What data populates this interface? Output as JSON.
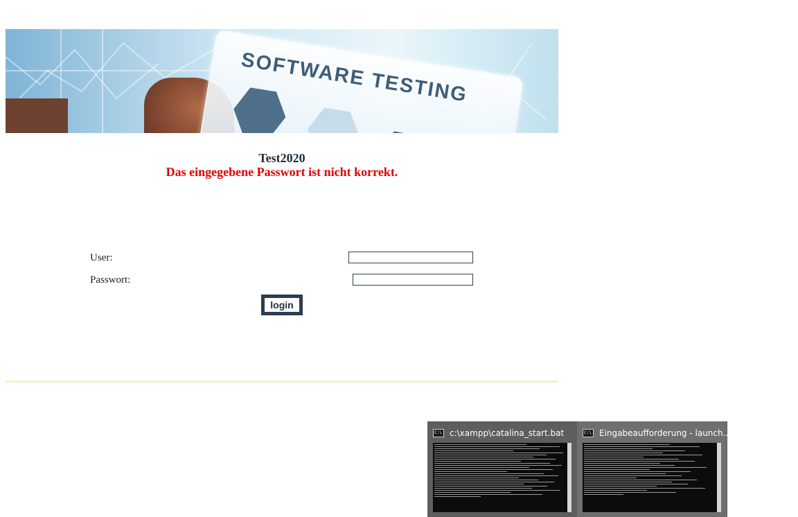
{
  "banner": {
    "text": "SOFTWARE TESTING"
  },
  "header": {
    "title": "Test2020",
    "error": "Das eingegebene Passwort ist nicht korrekt."
  },
  "form": {
    "user_label": "User:",
    "user_value": "",
    "password_label": "Passwort:",
    "password_value": "",
    "login_label": "login"
  },
  "taskbar_previews": [
    {
      "title": "c:\\xampp\\catalina_start.bat",
      "icon": "cmd-icon"
    },
    {
      "title": "Eingabeaufforderung - launch....",
      "icon": "cmd-icon"
    }
  ],
  "colors": {
    "error": "#e00000",
    "button_border": "#2c3e50",
    "divider": "#f8f0c8"
  }
}
